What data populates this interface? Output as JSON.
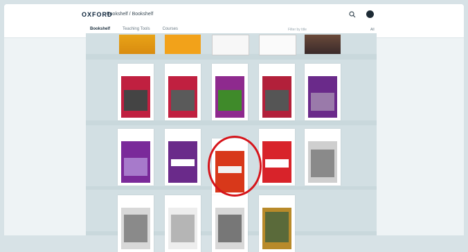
{
  "header": {
    "logo": "OXFORD",
    "breadcrumb": "Bookshelf / Bookshelf",
    "tabs": [
      {
        "label": "Bookshelf",
        "active": true
      },
      {
        "label": "Teaching Tools",
        "active": false
      },
      {
        "label": "Courses",
        "active": false
      }
    ],
    "filter_label": "Filter by title",
    "filter_value": "All"
  },
  "icons": [
    "search-icon",
    "user-avatar"
  ],
  "colors": {
    "highlight": "#d6151b",
    "brand": "#0a2239"
  },
  "books_row1": [
    {
      "name": "red-cover"
    },
    {
      "name": "red-cover"
    },
    {
      "name": "purple-green-cover"
    },
    {
      "name": "red-cover"
    },
    {
      "name": "purple-cover"
    }
  ],
  "books_row2": [
    {
      "name": "purple-cover"
    },
    {
      "name": "purple-cover"
    },
    {
      "name": "red-cover-selected",
      "selected": true
    },
    {
      "name": "red-cover"
    },
    {
      "name": "gray-cover"
    }
  ],
  "books_row3": [
    {
      "name": "gray-cover"
    },
    {
      "name": "gray-cover"
    },
    {
      "name": "gray-cover"
    },
    {
      "name": "photo-cover"
    }
  ]
}
